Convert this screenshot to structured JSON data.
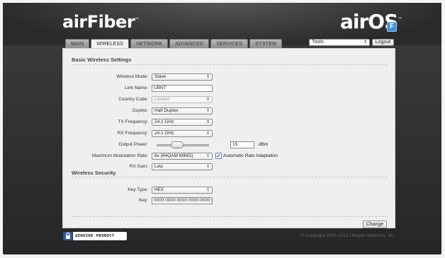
{
  "brand": {
    "left_logo": "airFiber",
    "right_logo": "airOS",
    "badge": "F"
  },
  "tabs": [
    {
      "label": "MAIN"
    },
    {
      "label": "WIRELESS"
    },
    {
      "label": "NETWORK"
    },
    {
      "label": "ADVANCED"
    },
    {
      "label": "SERVICES"
    },
    {
      "label": "SYSTEM"
    }
  ],
  "active_tab": "WIRELESS",
  "toolbar": {
    "tools_label": "Tools:",
    "logout_label": "Logout"
  },
  "basic": {
    "title": "Basic Wireless Settings",
    "wireless_mode": {
      "label": "Wireless Mode:",
      "value": "Slave"
    },
    "link_name": {
      "label": "Link Name:",
      "value": "UBNT"
    },
    "country_code": {
      "label": "Country Code:",
      "value": "Locked"
    },
    "duplex": {
      "label": "Duplex:",
      "value": "Half Duplex"
    },
    "tx_frequency": {
      "label": "TX Frequency:",
      "value": "24.1 GHz"
    },
    "rx_frequency": {
      "label": "RX Frequency:",
      "value": "24.1 GHz"
    },
    "output_power": {
      "label": "Output Power:",
      "value": "15",
      "unit": "dBm",
      "slider_level": 0.35
    },
    "max_mod_rate": {
      "label": "Maximum Modulation Rate:",
      "value": "6x (64QAM MIMO)"
    },
    "auto_rate": {
      "label": "Automatic Rate Adaptation",
      "checked": true
    },
    "rx_gain": {
      "label": "RX Gain:",
      "value": "Low"
    }
  },
  "security": {
    "title": "Wireless Security",
    "key_type": {
      "label": "Key Type:",
      "value": "HEX"
    },
    "key": {
      "label": "Key:",
      "value": "0000:0000:0000:0000:0000:0"
    }
  },
  "actions": {
    "change_label": "Change"
  },
  "footer": {
    "genuine": "GENUINE PRODUCT",
    "copyright": "© Copyright 2006-2012 Ubiquiti Networks, Inc."
  },
  "colors": {
    "accent_blue": "#3e8fd6",
    "header_dark": "#2a2a2a"
  }
}
